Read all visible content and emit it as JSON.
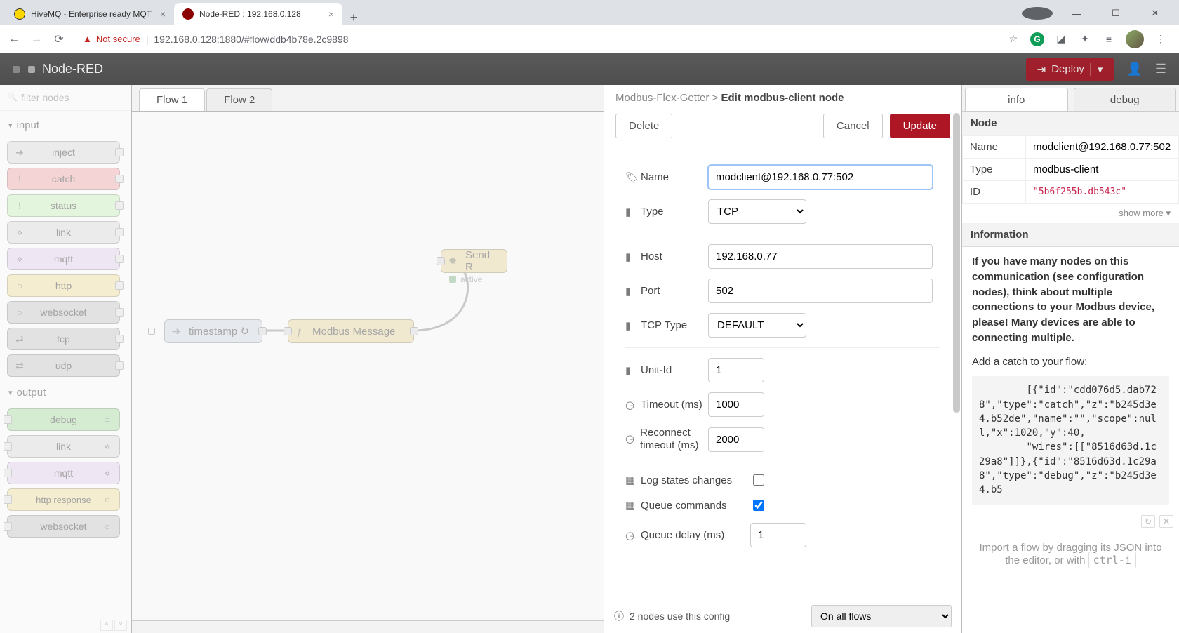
{
  "browser": {
    "tabs": [
      {
        "title": "HiveMQ - Enterprise ready MQT"
      },
      {
        "title": "Node-RED : 192.168.0.128"
      }
    ],
    "not_secure": "Not secure",
    "url": "192.168.0.128:1880/#flow/ddb4b78e.2c9898"
  },
  "header": {
    "title": "Node-RED",
    "deploy": "Deploy"
  },
  "palette": {
    "filter_placeholder": "filter nodes",
    "input_label": "input",
    "output_label": "output",
    "in": [
      "inject",
      "catch",
      "status",
      "link",
      "mqtt",
      "http",
      "websocket",
      "tcp",
      "udp"
    ],
    "out": [
      "debug",
      "link",
      "mqtt",
      "http response",
      "websocket"
    ]
  },
  "ws": {
    "tabs": [
      "Flow 1",
      "Flow 2"
    ],
    "nodes": {
      "ts": "timestamp",
      "mm": "Modbus Message",
      "sr": "Send R",
      "active": "active"
    }
  },
  "tray": {
    "crumb_a": "Modbus-Flex-Getter",
    "crumb_b": "Edit modbus-client node",
    "delete": "Delete",
    "cancel": "Cancel",
    "update": "Update",
    "labels": {
      "name": "Name",
      "type": "Type",
      "host": "Host",
      "port": "Port",
      "tcptype": "TCP Type",
      "unit": "Unit-Id",
      "timeout": "Timeout (ms)",
      "reconnect": "Reconnect timeout (ms)",
      "log": "Log states changes",
      "queue": "Queue commands",
      "qdelay": "Queue delay (ms)"
    },
    "vals": {
      "name": "modclient@192.168.0.77:502",
      "type": "TCP",
      "host": "192.168.0.77",
      "port": "502",
      "tcptype": "DEFAULT",
      "unit": "1",
      "timeout": "1000",
      "reconnect": "2000",
      "qdelay": "1"
    },
    "foot_text": "2 nodes use this config",
    "foot_select": "On all flows"
  },
  "sidebar": {
    "info_tab": "info",
    "debug_tab": "debug",
    "node_h": "Node",
    "info_h": "Information",
    "name_l": "Name",
    "type_l": "Type",
    "id_l": "ID",
    "name_v": "modclient@192.168.0.77:502",
    "type_v": "modbus-client",
    "id_v": "\"5b6f255b.db543c\"",
    "show_more": "show more ▾",
    "info_text": "If you have many nodes on this communication (see configuration nodes), think about multiple connections to your Modbus device, please! Many devices are able to connecting multiple.",
    "catch": "Add a catch to your flow:",
    "code": "        [{\"id\":\"cdd076d5.dab728\",\"type\":\"catch\",\"z\":\"b245d3e4.b52de\",\"name\":\"\",\"scope\":null,\"x\":1020,\"y\":40,\n        \"wires\":[[\"8516d63d.1c29a8\"]]},{\"id\":\"8516d63d.1c29a8\",\"type\":\"debug\",\"z\":\"b245d3e4.b5",
    "hint_a": "Import a flow by dragging its JSON into the editor, or with ",
    "hint_b": "ctrl-i"
  }
}
